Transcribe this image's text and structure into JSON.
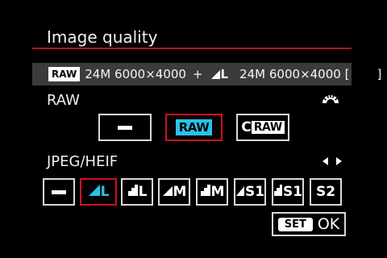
{
  "screen": {
    "title": "Image quality"
  },
  "info_bar": {
    "raw_badge": "RAW",
    "raw_spec": "24M 6000×4000",
    "plus": "+",
    "jpeg_size_letter": "L",
    "jpeg_spec": "24M 6000×4000 [",
    "bracket_close": "]"
  },
  "raw_section": {
    "label": "RAW",
    "options": [
      {
        "id": "none",
        "label": "—",
        "selected": false
      },
      {
        "id": "raw",
        "label": "RAW",
        "selected": true
      },
      {
        "id": "craw",
        "prefix": "C",
        "label": "RAW",
        "selected": false
      }
    ]
  },
  "jpeg_section": {
    "label": "JPEG/HEIF",
    "options": [
      {
        "id": "none",
        "label": "—",
        "selected": false
      },
      {
        "id": "fine-l",
        "label": "L",
        "quality": "fine",
        "selected": true
      },
      {
        "id": "normal-l",
        "label": "L",
        "quality": "normal",
        "selected": false
      },
      {
        "id": "fine-m",
        "label": "M",
        "quality": "fine",
        "selected": false
      },
      {
        "id": "normal-m",
        "label": "M",
        "quality": "normal",
        "selected": false
      },
      {
        "id": "fine-s1",
        "label": "S1",
        "quality": "fine",
        "selected": false
      },
      {
        "id": "normal-s1",
        "label": "S1",
        "quality": "normal",
        "selected": false
      },
      {
        "id": "s2",
        "label": "S2",
        "selected": false
      }
    ]
  },
  "footer": {
    "set_label": "SET",
    "ok_label": "OK"
  },
  "colors": {
    "accent_red": "#cf1020",
    "selected_cyan": "#29c3e8",
    "bar_grey": "#3b3b3b"
  },
  "icons": {
    "dial": "main-dial-icon",
    "left_right": "left-right-arrows-icon",
    "fine_quality": "fine-quality-icon",
    "normal_quality": "normal-quality-icon"
  }
}
